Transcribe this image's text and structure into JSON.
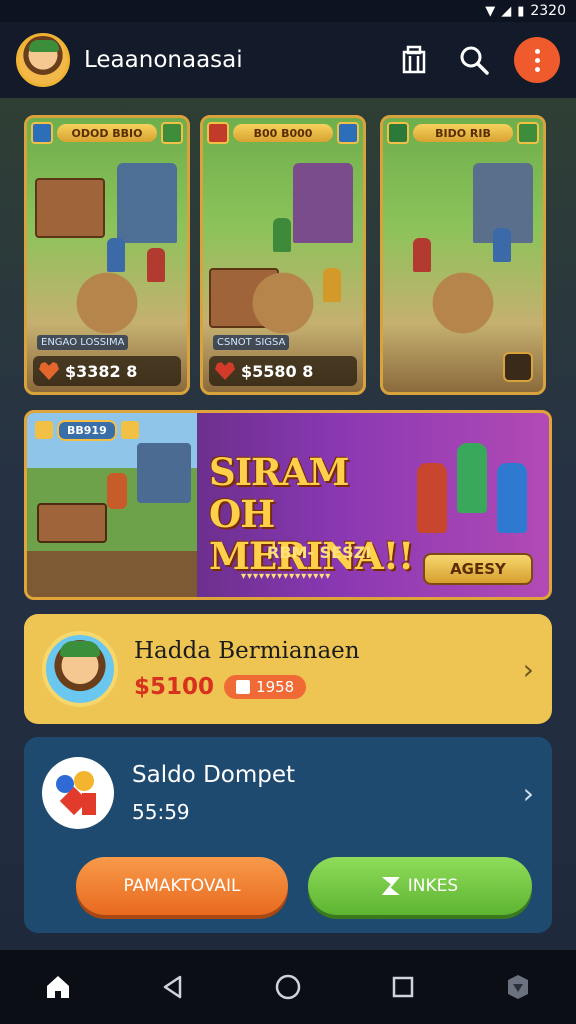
{
  "status_bar": {
    "time": "2320"
  },
  "header": {
    "title": "Leaanonaasai"
  },
  "cards": [
    {
      "label": "ODOD BBIO",
      "price": "$3382 8",
      "note": "ENGAO LOSSIMA"
    },
    {
      "label": "B00 B000",
      "price": "$5580 8",
      "note": "CSNOT SIGSA"
    },
    {
      "label": "BIDO RIB",
      "price": "",
      "note": ""
    }
  ],
  "banner": {
    "tag": "BB919",
    "title_line1": "SIRAM OH",
    "title_line2": "MERINA!!",
    "subtitle": "RBM- SESZI",
    "dots": "▾▾▾▾▾▾▾▾▾▾▾▾▾▾▾",
    "button": "AGESY"
  },
  "profile": {
    "name": "Hadda Bermianaen",
    "coins": "$5100",
    "pill": "1958"
  },
  "wallet": {
    "title": "Saldo Dompet",
    "balance": "55:59",
    "btn_left": "PAMAKTOVAIL",
    "btn_right": "INKES"
  },
  "colors": {
    "accent_orange": "#ef5b2c",
    "gold": "#eec452",
    "wallet_blue": "#1f4a70",
    "green_button": "#5db532"
  }
}
